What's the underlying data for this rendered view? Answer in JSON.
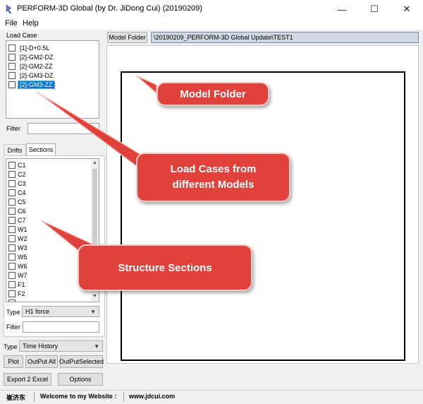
{
  "window": {
    "title": "PERFORM-3D Global (by Dr. JiDong Cui) (20190209)",
    "minimize_glyph": "—",
    "maximize_glyph": "☐",
    "close_glyph": "✕"
  },
  "menu": {
    "file": "File",
    "help": "Help"
  },
  "load_case": {
    "label": "Load Case",
    "items": [
      {
        "label": "[1]-D+0.5L",
        "checked": false,
        "selected": false
      },
      {
        "label": "[2]-GM2-DZ",
        "checked": false,
        "selected": false
      },
      {
        "label": "[2]-GM2-ZZ",
        "checked": false,
        "selected": false
      },
      {
        "label": "[2]-GM3-DZ",
        "checked": false,
        "selected": false
      },
      {
        "label": "[2]-GM3-ZZ",
        "checked": false,
        "selected": true
      }
    ],
    "filter_label": "Filter",
    "filter_value": ""
  },
  "tabs": {
    "drifts": "Drifts",
    "sections": "Sections",
    "active": "sections"
  },
  "sections": {
    "items": [
      "C1",
      "C2",
      "C3",
      "C4",
      "C5",
      "C6",
      "C7",
      "W1",
      "W2",
      "W3",
      "W5",
      "W6",
      "W7",
      "F1",
      "F2"
    ],
    "type_label": "Type",
    "type_value": "H1 force",
    "filter_label": "Filter",
    "filter_value": ""
  },
  "bottom": {
    "type_label": "Type",
    "type_value": "Time History",
    "plot": "Plot",
    "output_all": "OutPut All",
    "output_selected": "OutPutSelected",
    "export": "Export 2 Excel",
    "options": "Options"
  },
  "model_folder": {
    "button": "Model Folder",
    "path": "\\20190209_PERFORM-3D Global Update\\TEST1"
  },
  "status": {
    "author": "崔济东",
    "welcome": "Welcome to my Website :",
    "website": "www.jdcui.com"
  },
  "callouts": {
    "model_folder": "Model Folder",
    "load_cases": "Load Cases from different Models",
    "structure_sections": "Structure Sections"
  },
  "colors": {
    "callout": "#e0413a",
    "selection": "#0078d7",
    "path_field": "#cfd8e3"
  }
}
